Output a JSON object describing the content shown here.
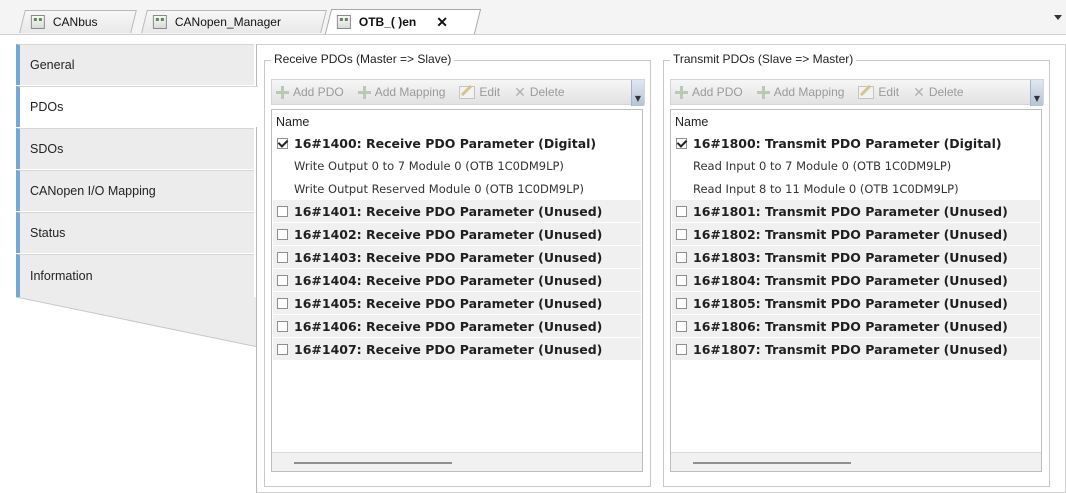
{
  "tabs": [
    {
      "label": "CANbus",
      "active": false,
      "closable": false
    },
    {
      "label": "CANopen_Manager",
      "active": false,
      "closable": false
    },
    {
      "label": "OTB_(       )en",
      "active": true,
      "closable": true
    }
  ],
  "tab_close_symbol": "✕",
  "nav": {
    "items": [
      {
        "label": "General",
        "active": false
      },
      {
        "label": "PDOs",
        "active": true
      },
      {
        "label": "SDOs",
        "active": false
      },
      {
        "label": "CANopen I/O Mapping",
        "active": false
      },
      {
        "label": "Status",
        "active": false
      },
      {
        "label": "Information",
        "active": false
      }
    ]
  },
  "receive": {
    "title": "Receive PDOs (Master => Slave)",
    "toolbar": {
      "add_pdo": "Add PDO",
      "add_mapping": "Add Mapping",
      "edit": "Edit",
      "delete": "Delete"
    },
    "column_header": "Name",
    "rows": [
      {
        "type": "pdo",
        "checked": true,
        "label": "16#1400: Receive PDO Parameter (Digital)"
      },
      {
        "type": "mapping",
        "label": "Write Output 0 to 7 Module 0 (OTB 1C0DM9LP)"
      },
      {
        "type": "mapping",
        "label": "Write Output Reserved Module 0 (OTB 1C0DM9LP)"
      },
      {
        "type": "pdo",
        "checked": false,
        "label": "16#1401: Receive PDO Parameter (Unused)"
      },
      {
        "type": "pdo",
        "checked": false,
        "label": "16#1402: Receive PDO Parameter (Unused)"
      },
      {
        "type": "pdo",
        "checked": false,
        "label": "16#1403: Receive PDO Parameter (Unused)"
      },
      {
        "type": "pdo",
        "checked": false,
        "label": "16#1404: Receive PDO Parameter (Unused)"
      },
      {
        "type": "pdo",
        "checked": false,
        "label": "16#1405: Receive PDO Parameter (Unused)"
      },
      {
        "type": "pdo",
        "checked": false,
        "label": "16#1406: Receive PDO Parameter (Unused)"
      },
      {
        "type": "pdo",
        "checked": false,
        "label": "16#1407: Receive PDO Parameter (Unused)"
      }
    ]
  },
  "transmit": {
    "title": "Transmit PDOs (Slave => Master)",
    "toolbar": {
      "add_pdo": "Add PDO",
      "add_mapping": "Add Mapping",
      "edit": "Edit",
      "delete": "Delete"
    },
    "column_header": "Name",
    "rows": [
      {
        "type": "pdo",
        "checked": true,
        "label": "16#1800: Transmit PDO Parameter (Digital)"
      },
      {
        "type": "mapping",
        "label": "Read Input 0 to 7 Module 0 (OTB 1C0DM9LP)"
      },
      {
        "type": "mapping",
        "label": "Read Input 8 to 11 Module 0 (OTB 1C0DM9LP)"
      },
      {
        "type": "pdo",
        "checked": false,
        "label": "16#1801: Transmit PDO Parameter (Unused)"
      },
      {
        "type": "pdo",
        "checked": false,
        "label": "16#1802: Transmit PDO Parameter (Unused)"
      },
      {
        "type": "pdo",
        "checked": false,
        "label": "16#1803: Transmit PDO Parameter (Unused)"
      },
      {
        "type": "pdo",
        "checked": false,
        "label": "16#1804: Transmit PDO Parameter (Unused)"
      },
      {
        "type": "pdo",
        "checked": false,
        "label": "16#1805: Transmit PDO Parameter (Unused)"
      },
      {
        "type": "pdo",
        "checked": false,
        "label": "16#1806: Transmit PDO Parameter (Unused)"
      },
      {
        "type": "pdo",
        "checked": false,
        "label": "16#1807: Transmit PDO Parameter (Unused)"
      }
    ]
  },
  "colors": {
    "nav_accent": "#73a9d6",
    "row_shade": "#f0f0f0",
    "toolbar_disabled_text": "#9a9a9a"
  }
}
